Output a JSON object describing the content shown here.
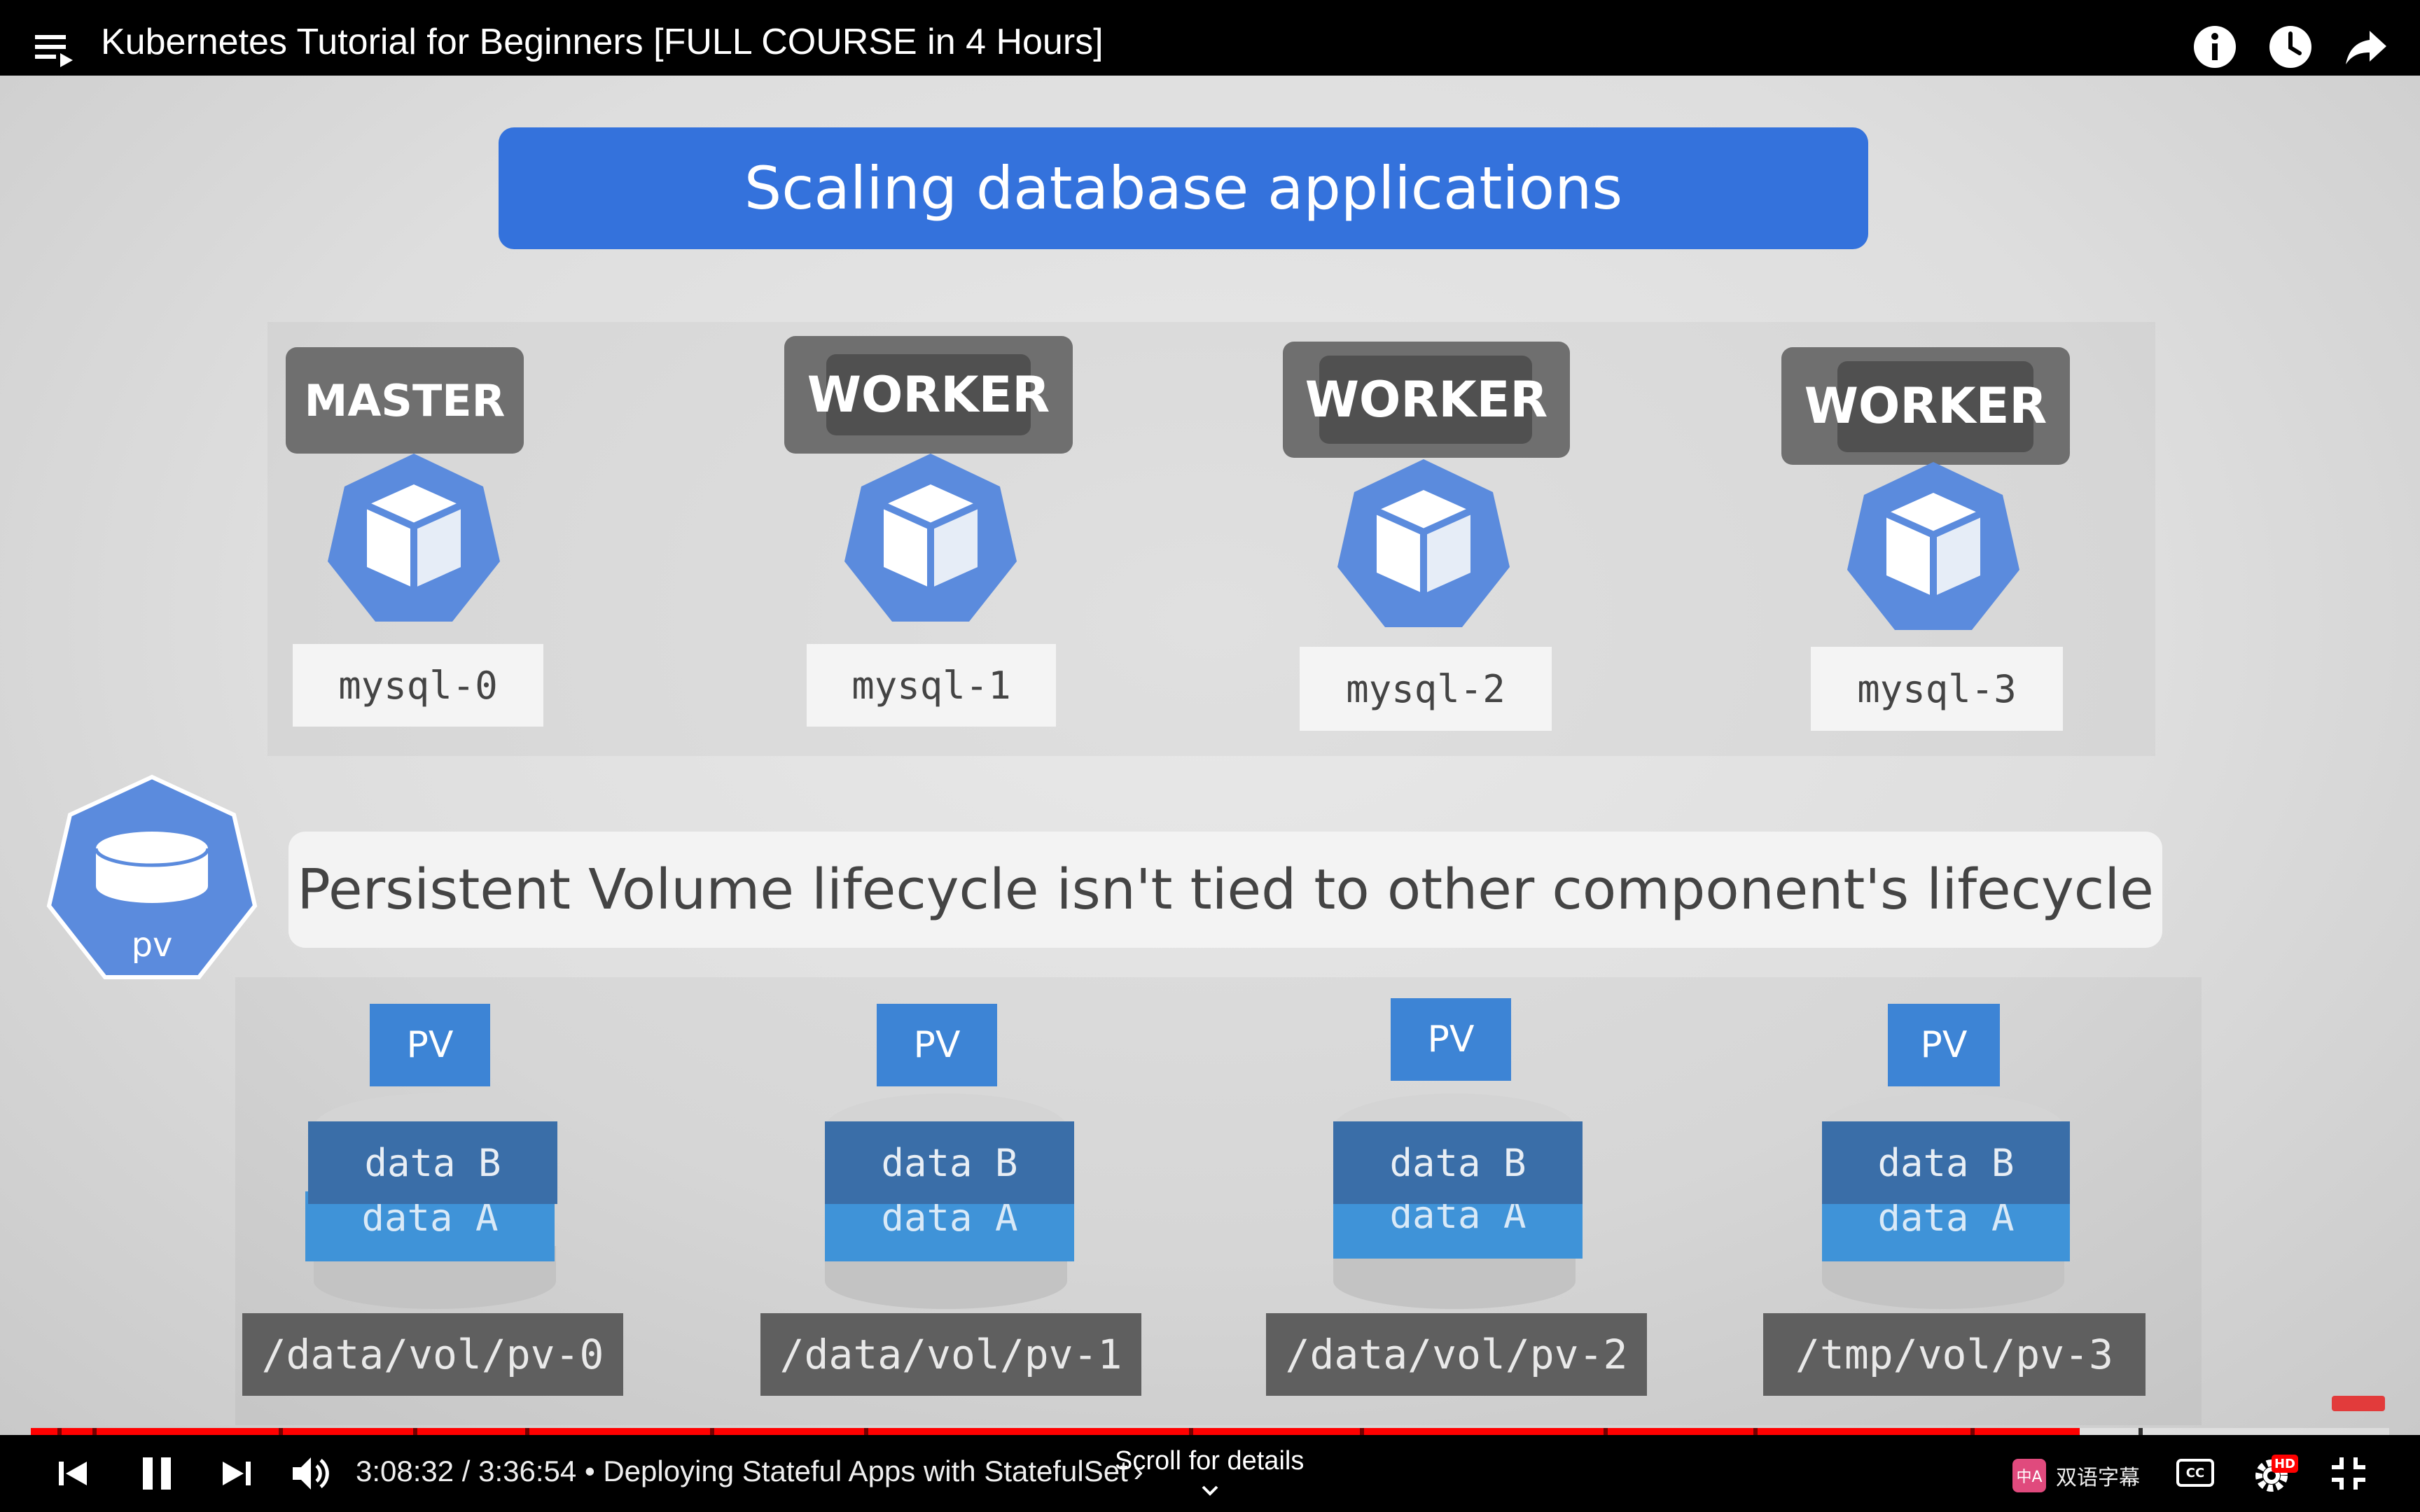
{
  "header": {
    "title": "Kubernetes Tutorial for Beginners [FULL COURSE in 4 Hours]",
    "icons": [
      "playlist-icon",
      "info-icon",
      "watch-later-icon",
      "share-icon"
    ]
  },
  "slide": {
    "title": "Scaling database applications",
    "nodes": [
      {
        "role": "MASTER",
        "pod": "mysql-0"
      },
      {
        "role": "WORKER",
        "pod": "mysql-1"
      },
      {
        "role": "WORKER",
        "pod": "mysql-2"
      },
      {
        "role": "WORKER",
        "pod": "mysql-3"
      }
    ],
    "pv_icon_label": "pv",
    "banner": "Persistent Volume lifecycle isn't tied to other component's lifecycle",
    "volumes": [
      {
        "tag": "PV",
        "data_b": "data B",
        "data_a": "data A",
        "path": "/data/vol/pv-0"
      },
      {
        "tag": "PV",
        "data_b": "data B",
        "data_a": "data A",
        "path": "/data/vol/pv-1"
      },
      {
        "tag": "PV",
        "data_b": "data B",
        "data_a": "data A",
        "path": "/data/vol/pv-2"
      },
      {
        "tag": "PV",
        "data_b": "data B",
        "data_a": "data A",
        "path": "/tmp/vol/pv-3"
      }
    ],
    "colors": {
      "accent_blue": "#3472dc",
      "kube_blue": "#5b8bdd",
      "pv_tag": "#3d84d5",
      "data_b": "#3a6ea8",
      "data_a": "#3f93d8"
    }
  },
  "player": {
    "time": "3:08:32 / 3:36:54",
    "chapter": "Deploying Stateful Apps with StatefulSet",
    "chapter_separator": " • ",
    "chapter_arrow": "›",
    "scroll_hint": "Scroll for details",
    "bilingual_label": "双语字幕",
    "bilingual_icon_text": "中A",
    "progress": 0.8688,
    "progress_color": "#ff0000",
    "hd_badge": "HD",
    "cc_label": "CC",
    "icons": [
      "previous-icon",
      "pause-icon",
      "next-icon",
      "volume-icon",
      "chevron-down-icon",
      "subtitles-icon",
      "settings-icon",
      "exit-fullscreen-icon"
    ]
  }
}
